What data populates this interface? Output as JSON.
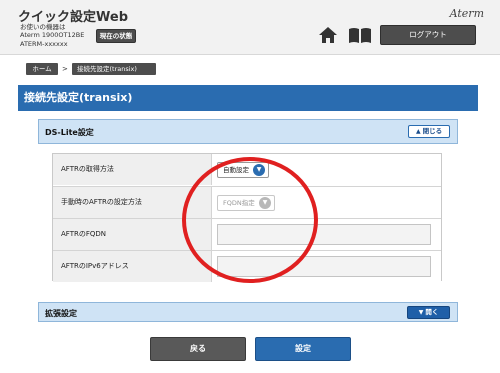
{
  "header": {
    "app_title": "クイック設定Web",
    "device_info": [
      "お使いの機器は",
      "Aterm 1900OT12BE",
      "ATERM-xxxxxx"
    ],
    "status_button": "現在の状態",
    "brand": "Aterm",
    "logout_button": "ログアウト",
    "icons": [
      "home-icon",
      "book-icon"
    ]
  },
  "breadcrumb": {
    "home": "ホーム",
    "separator": ">",
    "current": "接続先設定(transix)"
  },
  "page_title": "接続先設定(transix)",
  "ds_lite": {
    "label": "DS-Lite設定",
    "toggle_button": "閉じる",
    "rows": [
      {
        "label": "AFTRの取得方法",
        "value": "自動設定"
      },
      {
        "label": "手動時のAFTRの設定方法",
        "value": "FQDN指定"
      },
      {
        "label": "AFTRのFQDN",
        "value": ""
      },
      {
        "label": "AFTRのIPv6アドレス",
        "value": ""
      }
    ]
  },
  "extended": {
    "label": "拡張設定",
    "toggle_button": "開く"
  },
  "footer": {
    "back_button": "戻る",
    "apply_button": "設定"
  },
  "colors": {
    "accent_blue": "#2a6cb0",
    "panel_blue": "#cfe3f5",
    "dark_button": "#4d4d4d",
    "annotation_red": "#e02020"
  }
}
